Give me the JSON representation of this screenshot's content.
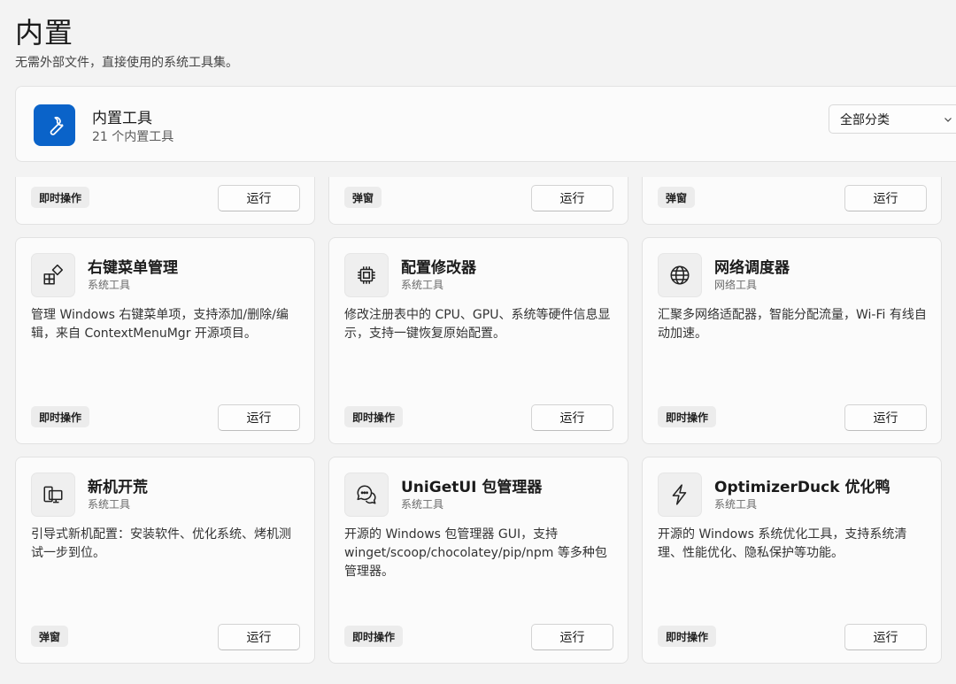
{
  "page": {
    "title": "内置",
    "subtitle": "无需外部文件，直接使用的系统工具集。"
  },
  "header": {
    "icon": "wrench-icon",
    "accent": "#0a63c9",
    "title": "内置工具",
    "count": "21 个内置工具",
    "filter": "全部分类"
  },
  "top_row": [
    {
      "tag": "即时操作",
      "run": "运行"
    },
    {
      "tag": "弹窗",
      "run": "运行"
    },
    {
      "tag": "弹窗",
      "run": "运行"
    }
  ],
  "cards": [
    {
      "icon": "context-menu-icon",
      "title": "右键菜单管理",
      "category": "系统工具",
      "desc": "管理 Windows 右键菜单项，支持添加/删除/编辑，来自 ContextMenuMgr 开源项目。",
      "tag": "即时操作",
      "run": "运行"
    },
    {
      "icon": "chip-icon",
      "title": "配置修改器",
      "category": "系统工具",
      "desc": "修改注册表中的 CPU、GPU、系统等硬件信息显示，支持一键恢复原始配置。",
      "tag": "即时操作",
      "run": "运行"
    },
    {
      "icon": "globe-icon",
      "title": "网络调度器",
      "category": "网络工具",
      "desc": "汇聚多网络适配器，智能分配流量，Wi-Fi 有线自动加速。",
      "tag": "即时操作",
      "run": "运行"
    },
    {
      "icon": "new-pc-icon",
      "title": "新机开荒",
      "category": "系统工具",
      "desc": "引导式新机配置：安装软件、优化系统、烤机测试一步到位。",
      "tag": "弹窗",
      "run": "运行"
    },
    {
      "icon": "chat-bubbles-icon",
      "title": "UniGetUI 包管理器",
      "category": "系统工具",
      "desc": "开源的 Windows 包管理器 GUI，支持 winget/scoop/chocolatey/pip/npm 等多种包管理器。",
      "tag": "即时操作",
      "run": "运行"
    },
    {
      "icon": "lightning-icon",
      "title": "OptimizerDuck 优化鸭",
      "category": "系统工具",
      "desc": "开源的 Windows 系统优化工具，支持系统清理、性能优化、隐私保护等功能。",
      "tag": "即时操作",
      "run": "运行"
    }
  ]
}
